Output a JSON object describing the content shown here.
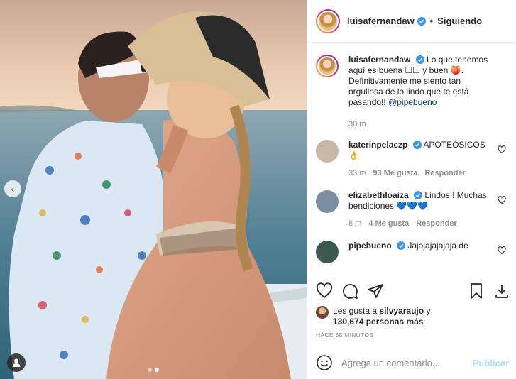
{
  "post": {
    "author": {
      "username": "luisafernandaw",
      "verified": true,
      "follow_separator": "•",
      "follow_status": "Siguiendo"
    },
    "caption": {
      "username": "luisafernandaw",
      "text_part1": "Lo que tenemos aquí es buena ",
      "emoji1": "☐☐",
      "text_part2": " y buen ",
      "emoji2": "🍑",
      "text_part3": ". Definitivamente me siento tan orgullosa de lo lindo que te está pasando!! ",
      "mention": "@pipebueno",
      "time": "38 m"
    },
    "comments": [
      {
        "username": "katerinpelaezp",
        "verified": true,
        "text": "APOTEÓSICOS",
        "emoji": "👌",
        "time": "33 m",
        "likes": "93 Me gusta",
        "reply": "Responder",
        "avatar_color": "#c7b7a3"
      },
      {
        "username": "elizabethloaiza",
        "verified": true,
        "text": "Lindos ! Muchas bendiciones",
        "emoji": "💙💙💙",
        "time": "8 m",
        "likes": "4 Me gusta",
        "reply": "Responder",
        "avatar_color": "#7c8fa3"
      },
      {
        "username": "pipebueno",
        "verified": true,
        "text": "Jajajajajajaja de",
        "avatar_color": "#3d5a4f"
      }
    ],
    "likes": {
      "prefix": "Les gusta a",
      "user": "silvyaraujo",
      "connector": "y",
      "count": "130,674 personas más"
    },
    "timestamp": "HACE 38 MINUTOS",
    "comment_box": {
      "placeholder": "Agrega un comentario...",
      "publish_label": "Publicar"
    },
    "carousel": {
      "total": 2,
      "active_index": 1
    },
    "icons": {
      "like": "heart-icon",
      "comment": "comment-bubble-icon",
      "share": "paper-plane-icon",
      "save": "bookmark-icon",
      "download": "download-icon",
      "emoji": "smiley-icon",
      "tag": "user-tag-icon",
      "prev": "chevron-left-icon"
    },
    "colors": {
      "verified": "#3897f0",
      "link": "#00376b",
      "muted": "#8e8e8e",
      "publish_disabled": "#b2dffc"
    }
  }
}
